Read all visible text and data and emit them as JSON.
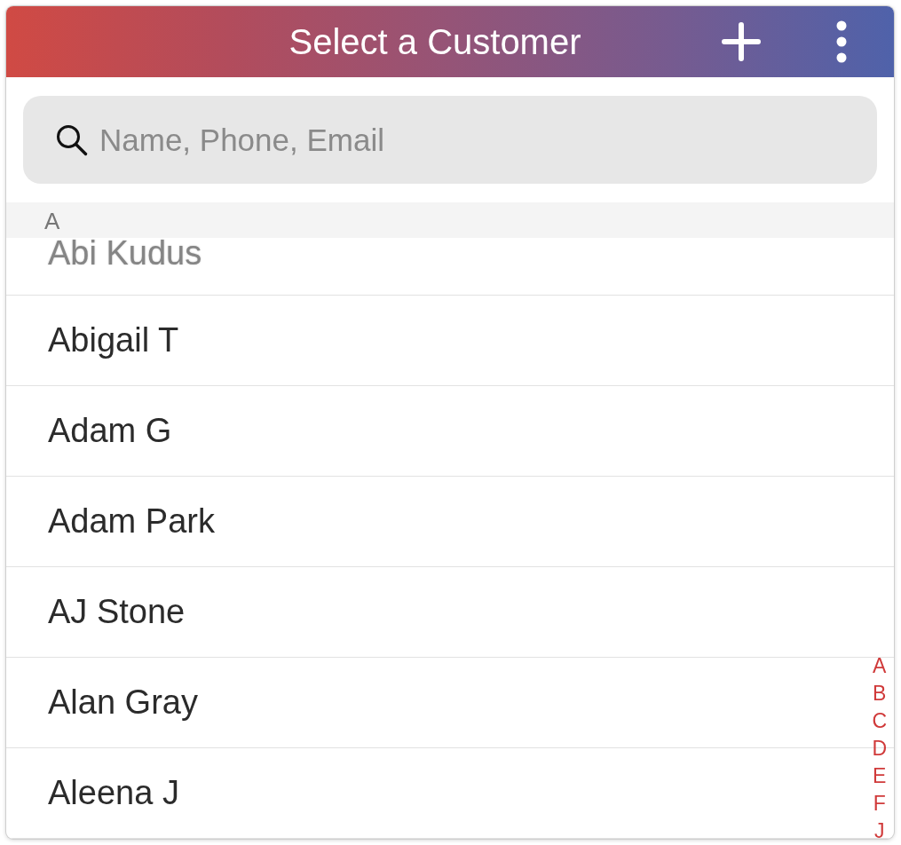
{
  "header": {
    "title": "Select a Customer"
  },
  "search": {
    "placeholder": "Name, Phone, Email"
  },
  "sections": [
    {
      "letter": "A",
      "customers": [
        {
          "name": "Abi Kudus",
          "faded": true
        },
        {
          "name": "Abigail T",
          "faded": false
        },
        {
          "name": "Adam G",
          "faded": false
        },
        {
          "name": "Adam Park",
          "faded": false
        },
        {
          "name": "AJ Stone",
          "faded": false
        },
        {
          "name": "Alan Gray",
          "faded": false
        },
        {
          "name": "Aleena J",
          "faded": false
        }
      ]
    }
  ],
  "index": [
    "A",
    "B",
    "C",
    "D",
    "E",
    "F",
    "J"
  ]
}
